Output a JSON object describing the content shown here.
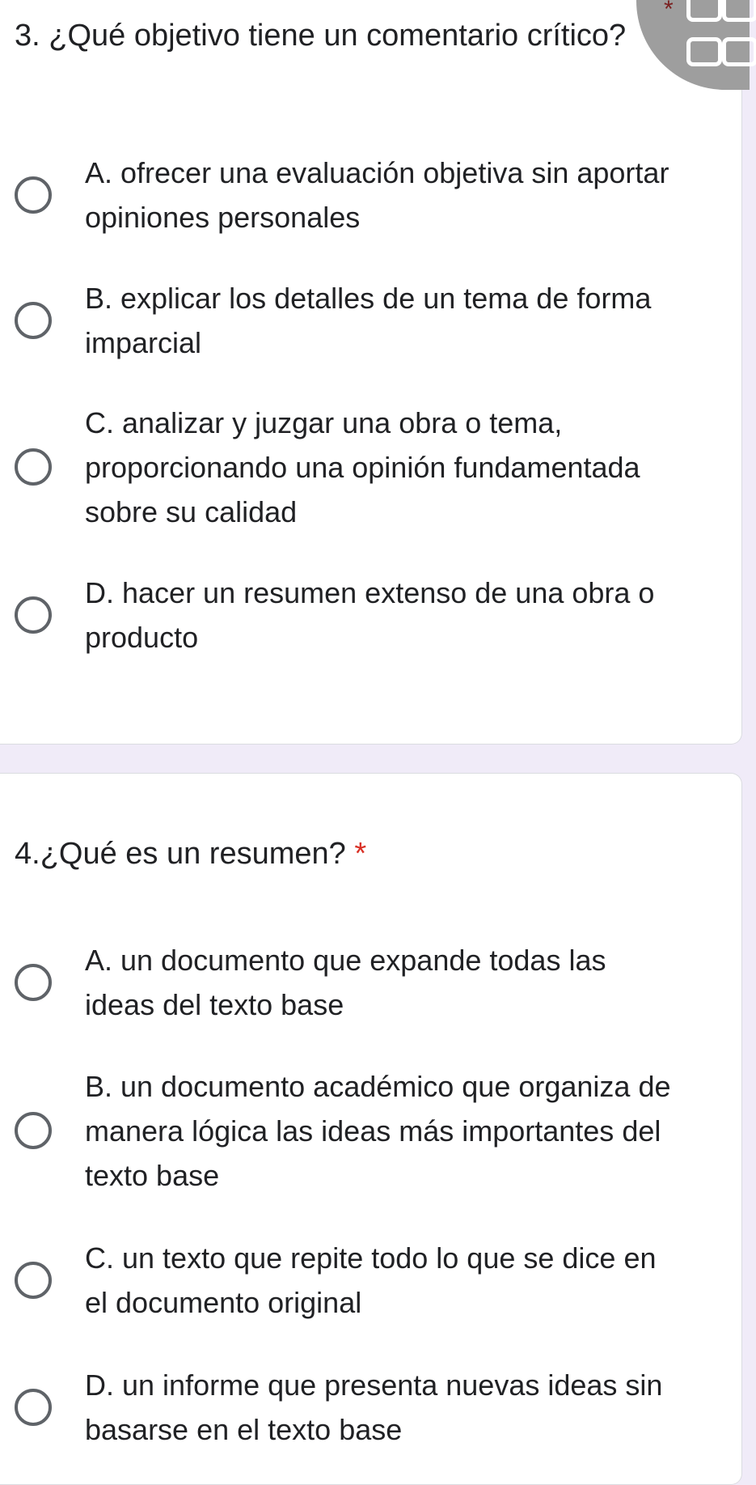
{
  "questions": [
    {
      "title": "3. ¿Qué objetivo tiene un comentario crítico?",
      "required_marker": "*",
      "options": [
        "A. ofrecer una evaluación objetiva sin aportar opiniones personales",
        "B. explicar los detalles de un tema de forma imparcial",
        "C. analizar y juzgar una obra o tema, proporcionando una opinión fundamentada sobre su calidad",
        "D. hacer un resumen extenso de una obra o producto"
      ]
    },
    {
      "title": "4.¿Qué es un resumen?",
      "required_marker": "*",
      "options": [
        "A. un documento que expande todas las ideas del texto base",
        "B. un documento académico que organiza de manera lógica las ideas más importantes del texto base",
        "C. un texto que repite todo lo que se dice en el documento original",
        "D. un informe que presenta nuevas ideas sin basarse en el texto base"
      ]
    }
  ],
  "colors": {
    "background": "#f0ebf8",
    "card": "#ffffff",
    "required": "#d93025",
    "radio_border": "#5f6368"
  }
}
